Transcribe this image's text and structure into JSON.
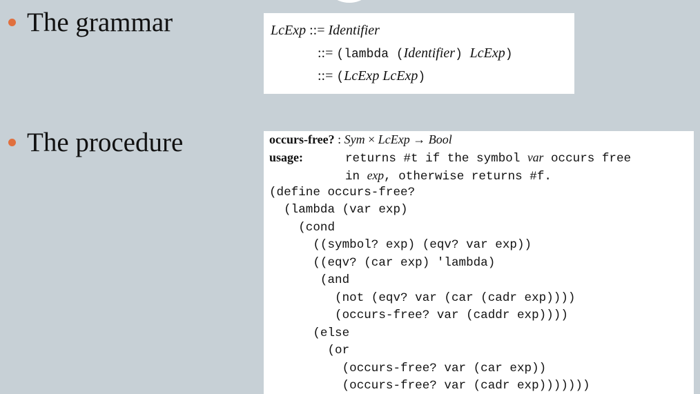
{
  "bullets": {
    "grammar": "The grammar",
    "procedure": "The procedure"
  },
  "grammar": {
    "line1_lhs": "LcExp",
    "line1_op": " ::= ",
    "line1_rhs": "Identifier",
    "line2_op": "::= ",
    "line2_open": "(lambda (",
    "line2_id": "Identifier",
    "line2_mid": ") ",
    "line2_exp": "LcExp",
    "line2_close": ")",
    "line3_op": "::= ",
    "line3_open": "(",
    "line3_exp1": "LcExp",
    "line3_sp": " ",
    "line3_exp2": "LcExp",
    "line3_close": ")"
  },
  "procedure": {
    "sig_name": "occurs-free?",
    "sig_colon": " : ",
    "sig_sym": "Sym",
    "sig_times": " × ",
    "sig_lcexp": "LcExp",
    "sig_arrow": " → ",
    "sig_bool": "Bool",
    "usage_label": "usage:",
    "usage_line1_a": "returns #t if the symbol ",
    "usage_line1_var": "var",
    "usage_line1_b": " occurs free",
    "usage_line2_a": "in ",
    "usage_line2_exp": "exp",
    "usage_line2_b": ", otherwise returns #f.",
    "code": [
      "(define occurs-free?",
      "  (lambda (var exp)",
      "    (cond",
      "      ((symbol? exp) (eqv? var exp))",
      "      ((eqv? (car exp) 'lambda)",
      "       (and",
      "         (not (eqv? var (car (cadr exp))))",
      "         (occurs-free? var (caddr exp))))",
      "      (else",
      "        (or",
      "          (occurs-free? var (car exp))",
      "          (occurs-free? var (cadr exp)))))))"
    ]
  }
}
